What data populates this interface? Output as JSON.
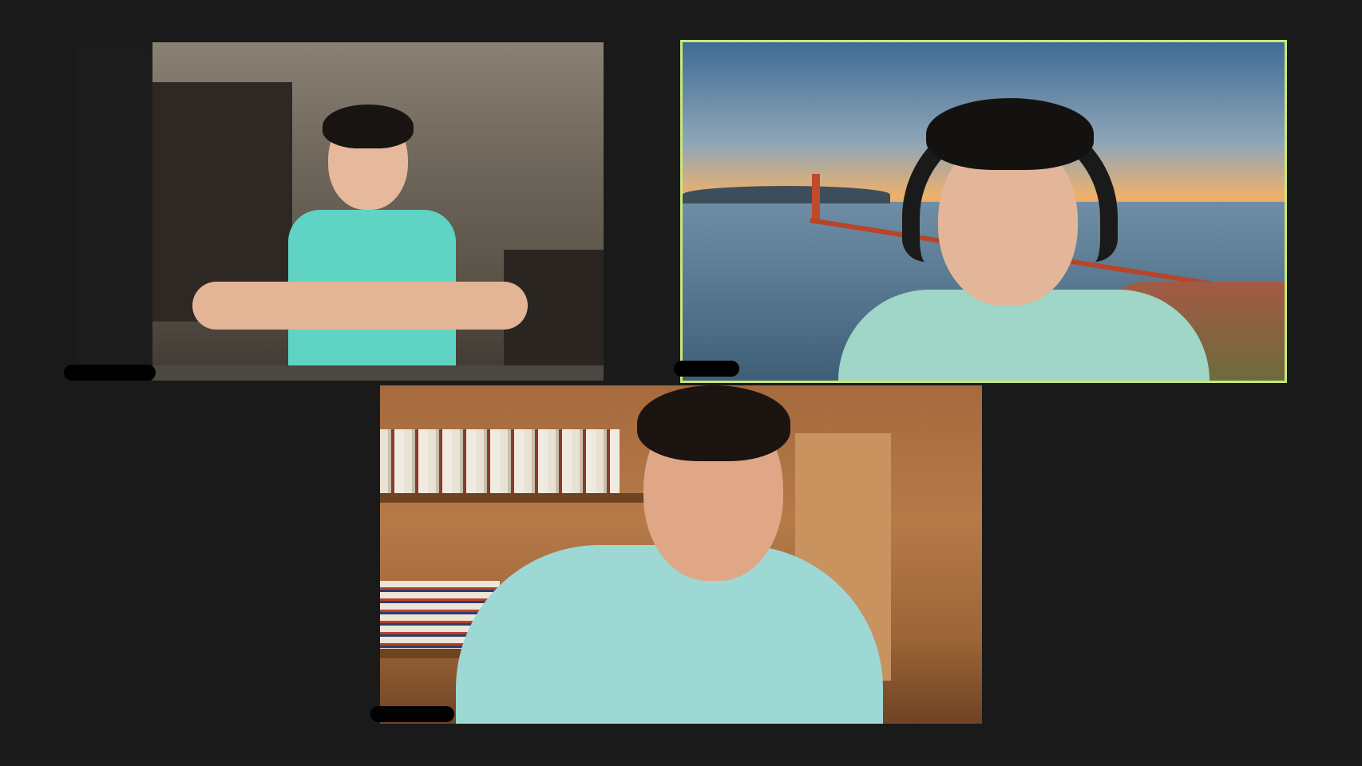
{
  "window": {
    "view_mode": "gallery",
    "background_color": "#1a1a1a"
  },
  "participants": [
    {
      "name_label": "",
      "name_redacted": true,
      "video_on": true,
      "active_speaker": false
    },
    {
      "name_label": "",
      "name_redacted": true,
      "video_on": true,
      "active_speaker": true,
      "virtual_background": "golden-gate-bridge-sunset",
      "highlight_color": "#c9e77a"
    },
    {
      "name_label": "",
      "name_redacted": true,
      "video_on": true,
      "active_speaker": false
    }
  ]
}
